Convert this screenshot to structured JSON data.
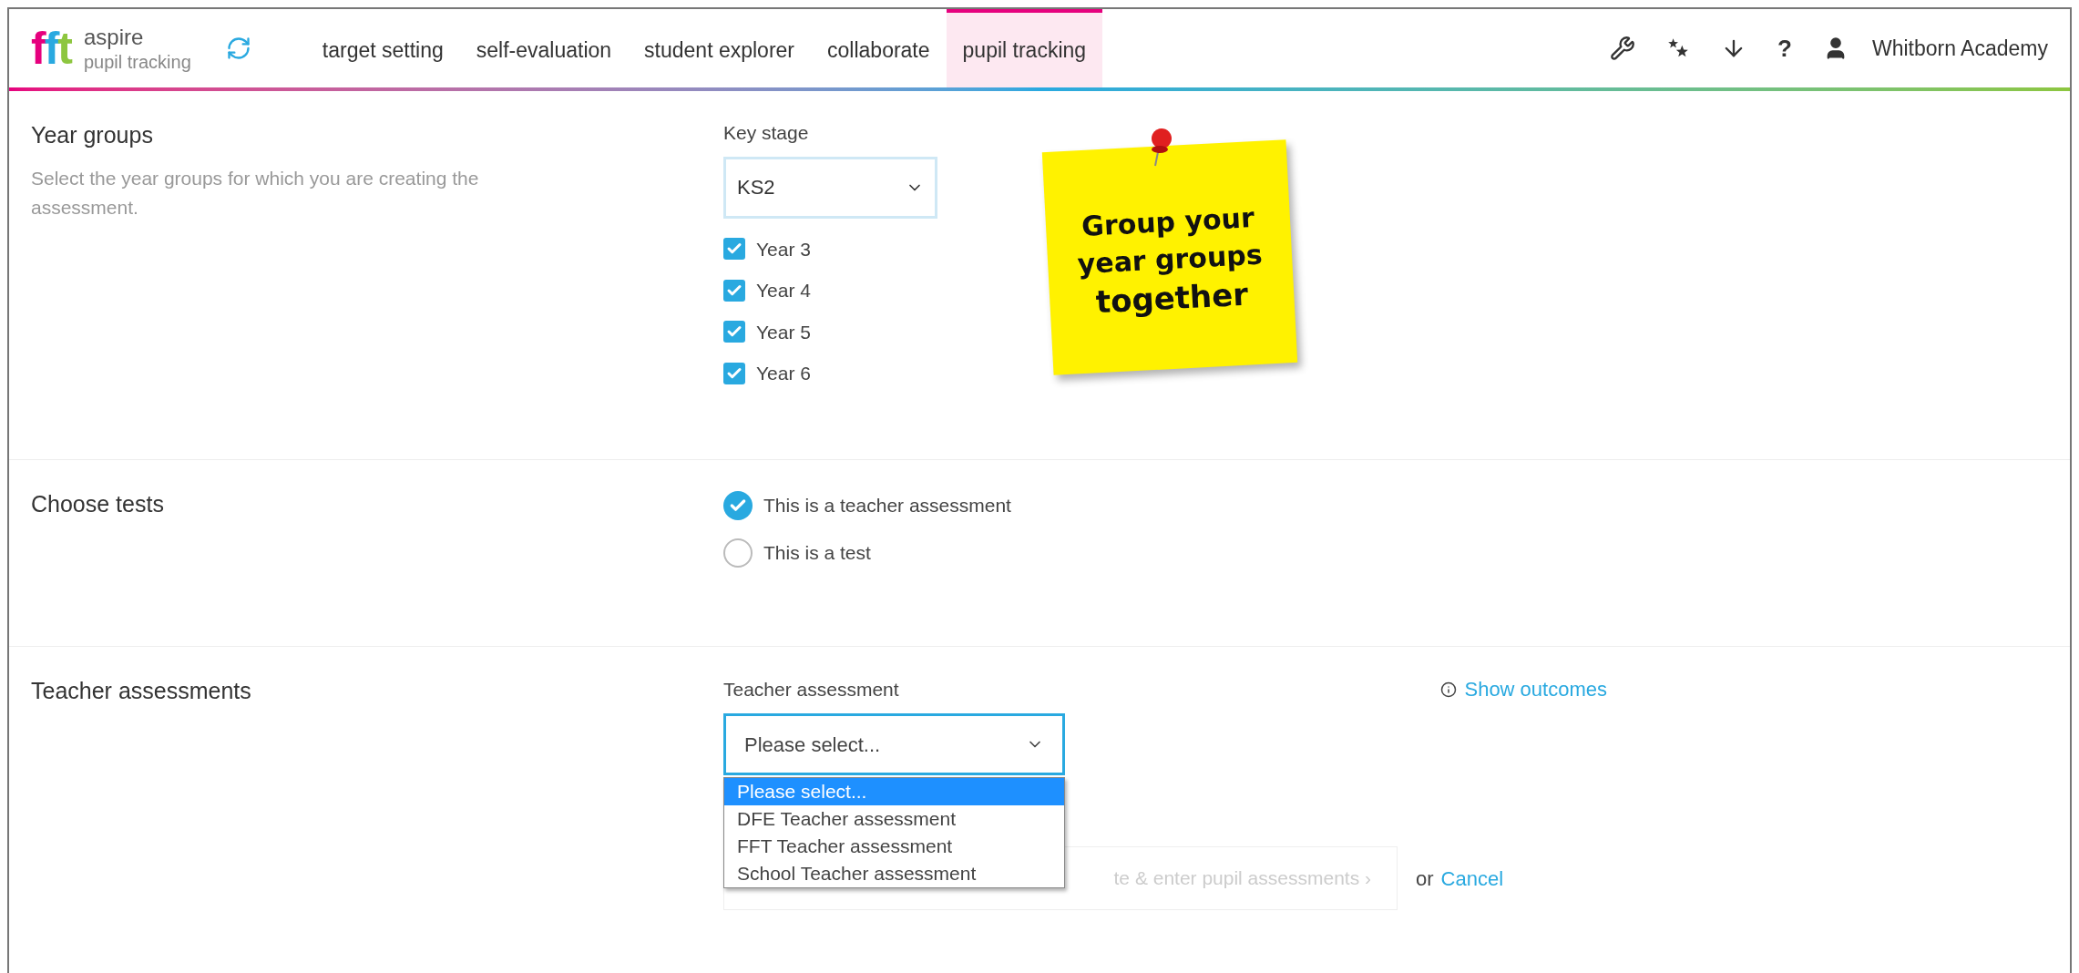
{
  "header": {
    "logo": {
      "mark": "fft",
      "name": "aspire",
      "product": "pupil tracking"
    },
    "nav": [
      {
        "label": "target setting",
        "selected": false
      },
      {
        "label": "self-evaluation",
        "selected": false
      },
      {
        "label": "student explorer",
        "selected": false
      },
      {
        "label": "collaborate",
        "selected": false
      },
      {
        "label": "pupil tracking",
        "selected": true
      }
    ],
    "help": "?",
    "school": "Whitborn Academy"
  },
  "year_groups": {
    "title": "Year groups",
    "description": "Select the year groups for which you are creating the assessment.",
    "field_label": "Key stage",
    "select_value": "KS2",
    "options": [
      {
        "label": "Year 3",
        "checked": true
      },
      {
        "label": "Year 4",
        "checked": true
      },
      {
        "label": "Year 5",
        "checked": true
      },
      {
        "label": "Year 6",
        "checked": true
      }
    ]
  },
  "note": {
    "lines": [
      "Group your",
      "year groups",
      "together"
    ]
  },
  "tests": {
    "title": "Choose tests",
    "options": [
      {
        "label": "This is a teacher assessment",
        "selected": true
      },
      {
        "label": "This is a test",
        "selected": false
      }
    ]
  },
  "teacher": {
    "title": "Teacher assessments",
    "field_label": "Teacher assessment",
    "select_value": "Please select...",
    "link": "Show outcomes",
    "dropdown": [
      {
        "label": "Please select...",
        "selected": true
      },
      {
        "label": "DFE Teacher assessment",
        "selected": false
      },
      {
        "label": "FFT Teacher assessment",
        "selected": false
      },
      {
        "label": "School Teacher assessment",
        "selected": false
      }
    ],
    "button": "te & enter pupil assessments ›",
    "or": "or",
    "cancel": "Cancel"
  }
}
